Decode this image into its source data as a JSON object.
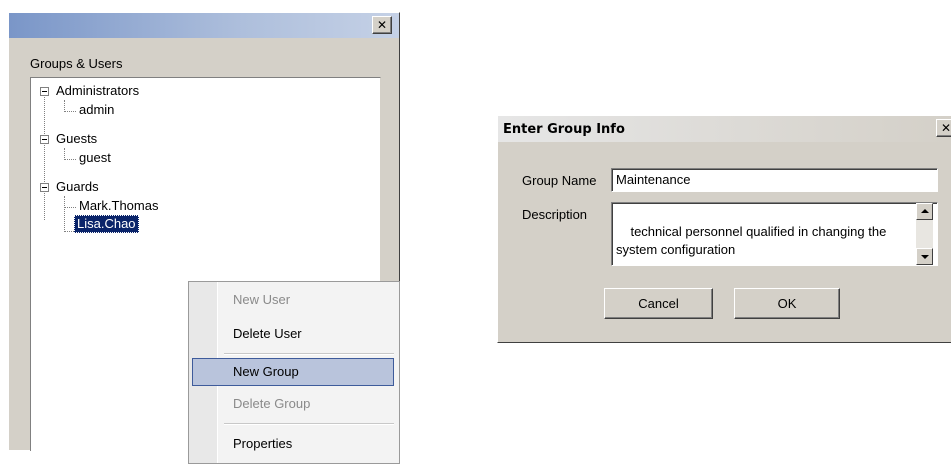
{
  "left_window": {
    "close_glyph": "✕",
    "group_box_title": "Groups & Users",
    "tree": {
      "groups": [
        {
          "label": "Administrators",
          "users": [
            "admin"
          ]
        },
        {
          "label": "Guests",
          "users": [
            "guest"
          ]
        },
        {
          "label": "Guards",
          "users": [
            "Mark.Thomas",
            "Lisa.Chao"
          ]
        }
      ],
      "selected_user": "Lisa.Chao"
    },
    "context_menu": {
      "items": [
        {
          "label": "New User",
          "enabled": false
        },
        {
          "label": "Delete User",
          "enabled": true
        },
        {
          "label": "New Group",
          "enabled": true,
          "highlighted": true
        },
        {
          "label": "Delete Group",
          "enabled": false
        },
        {
          "label": "Properties",
          "enabled": true
        }
      ]
    }
  },
  "dialog": {
    "title": "Enter Group Info",
    "close_glyph": "✕",
    "group_name_label": "Group Name",
    "group_name_value": "Maintenance",
    "description_label": "Description",
    "description_value": "technical personnel qualified in changing the system configuration",
    "cancel_label": "Cancel",
    "ok_label": "OK"
  },
  "colors": {
    "window_face": "#d4d0c8",
    "selection": "#0a246a",
    "menu_highlight": "#b9c4dc"
  }
}
